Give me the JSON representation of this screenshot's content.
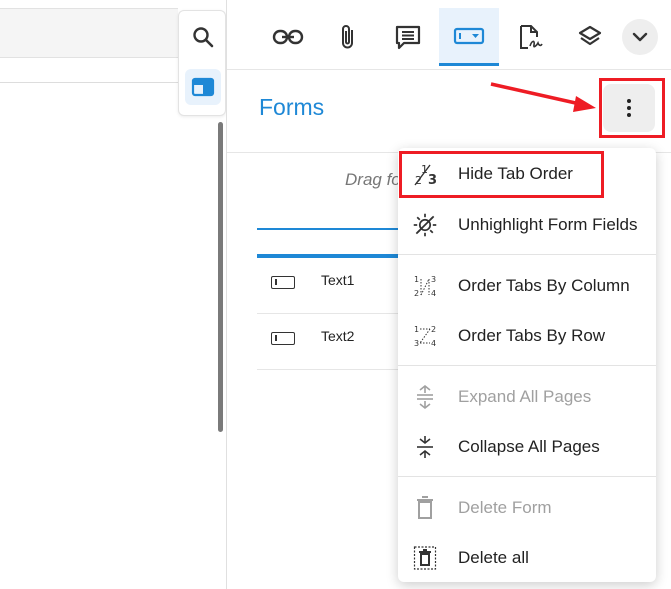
{
  "side_toolbar": {
    "items": [
      {
        "icon": "search-icon"
      },
      {
        "icon": "panel-icon",
        "active": true
      }
    ]
  },
  "top_toolbar": {
    "items": [
      {
        "icon": "link-icon"
      },
      {
        "icon": "paperclip-icon"
      },
      {
        "icon": "comment-icon"
      },
      {
        "icon": "form-field-icon",
        "active": true
      },
      {
        "icon": "signature-icon"
      },
      {
        "icon": "layers-icon"
      },
      {
        "icon": "chevron-down-icon"
      }
    ]
  },
  "forms_panel": {
    "title": "Forms",
    "drag_hint": "Drag fo",
    "fields": [
      {
        "label": "Text1",
        "icon": "text-field-icon"
      },
      {
        "label": "Text2",
        "icon": "text-field-icon"
      }
    ]
  },
  "menu": {
    "items": [
      {
        "label": "Hide Tab Order",
        "icon": "tab-order-icon",
        "enabled": true
      },
      {
        "label": "Unhighlight Form Fields",
        "icon": "unhighlight-icon",
        "enabled": true
      },
      {
        "label": "Order Tabs By Column",
        "icon": "order-column-icon",
        "enabled": true
      },
      {
        "label": "Order Tabs By Row",
        "icon": "order-row-icon",
        "enabled": true
      },
      {
        "label": "Expand All Pages",
        "icon": "expand-icon",
        "enabled": false
      },
      {
        "label": "Collapse All Pages",
        "icon": "collapse-icon",
        "enabled": true
      },
      {
        "label": "Delete Form",
        "icon": "trash-icon",
        "enabled": false
      },
      {
        "label": "Delete all",
        "icon": "delete-all-icon",
        "enabled": true
      }
    ]
  },
  "colors": {
    "accent": "#1e88d6",
    "annotation": "#ee1c24",
    "disabled": "#a0a0a0"
  }
}
